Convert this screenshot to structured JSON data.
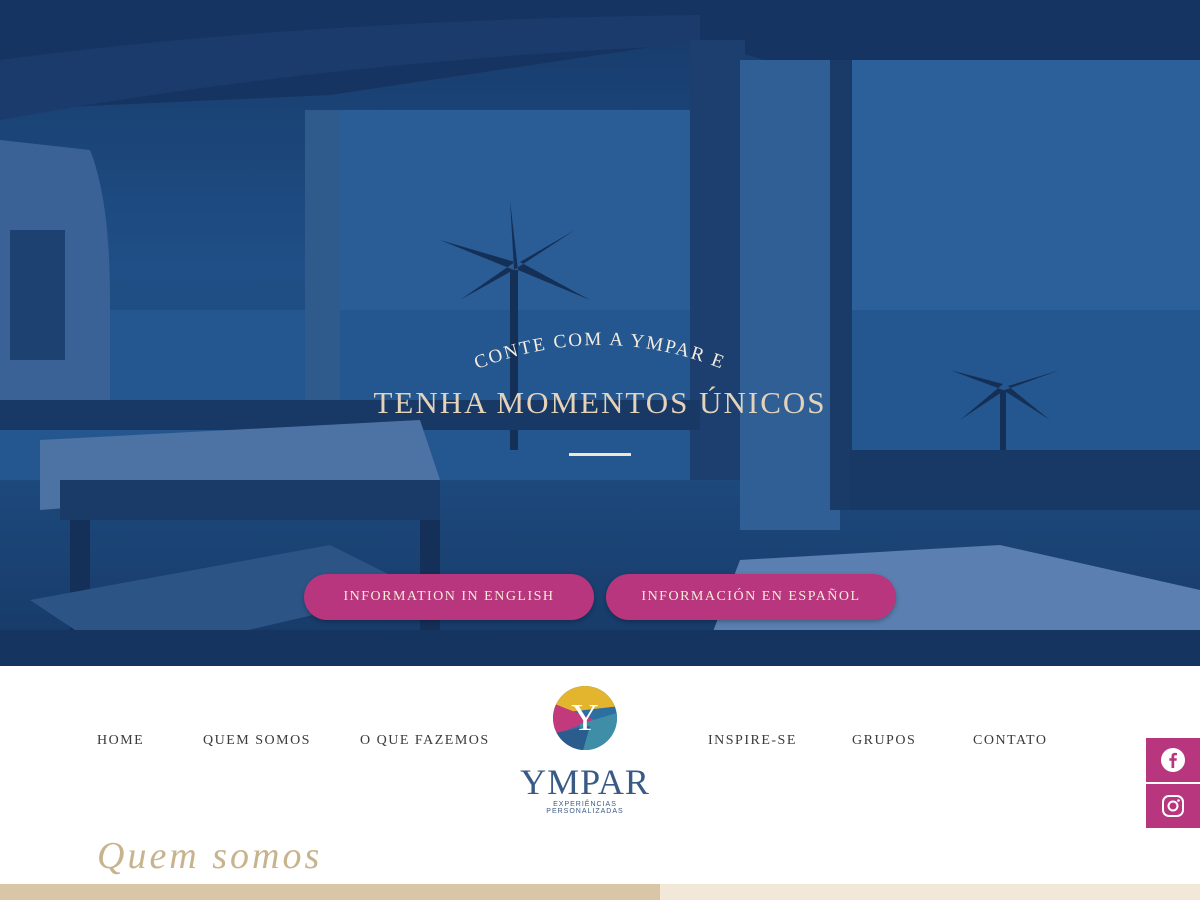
{
  "hero": {
    "kicker": "CONTE COM A YMPAR E",
    "headline": "TENHA MOMENTOS ÚNICOS",
    "buttons": [
      {
        "label": "INFORMATION IN ENGLISH"
      },
      {
        "label": "INFORMACIÓN EN ESPAÑOL"
      }
    ]
  },
  "nav": {
    "items": [
      "HOME",
      "QUEM SOMOS",
      "O QUE FAZEMOS",
      "INSPIRE-SE",
      "GRUPOS",
      "CONTATO"
    ]
  },
  "logo": {
    "letter": "Y",
    "wordmark": "YMPAR",
    "tagline": "EXPERIÊNCIAS PERSONALIZADAS"
  },
  "social": {
    "facebook": "facebook-icon",
    "instagram": "instagram-icon"
  },
  "section": {
    "title": "Quem somos"
  },
  "colors": {
    "hero_blue": "#1f4f86",
    "accent_magenta": "#b7367e",
    "gold_text": "#c7b48e",
    "logo_blue": "#3a5a86"
  }
}
